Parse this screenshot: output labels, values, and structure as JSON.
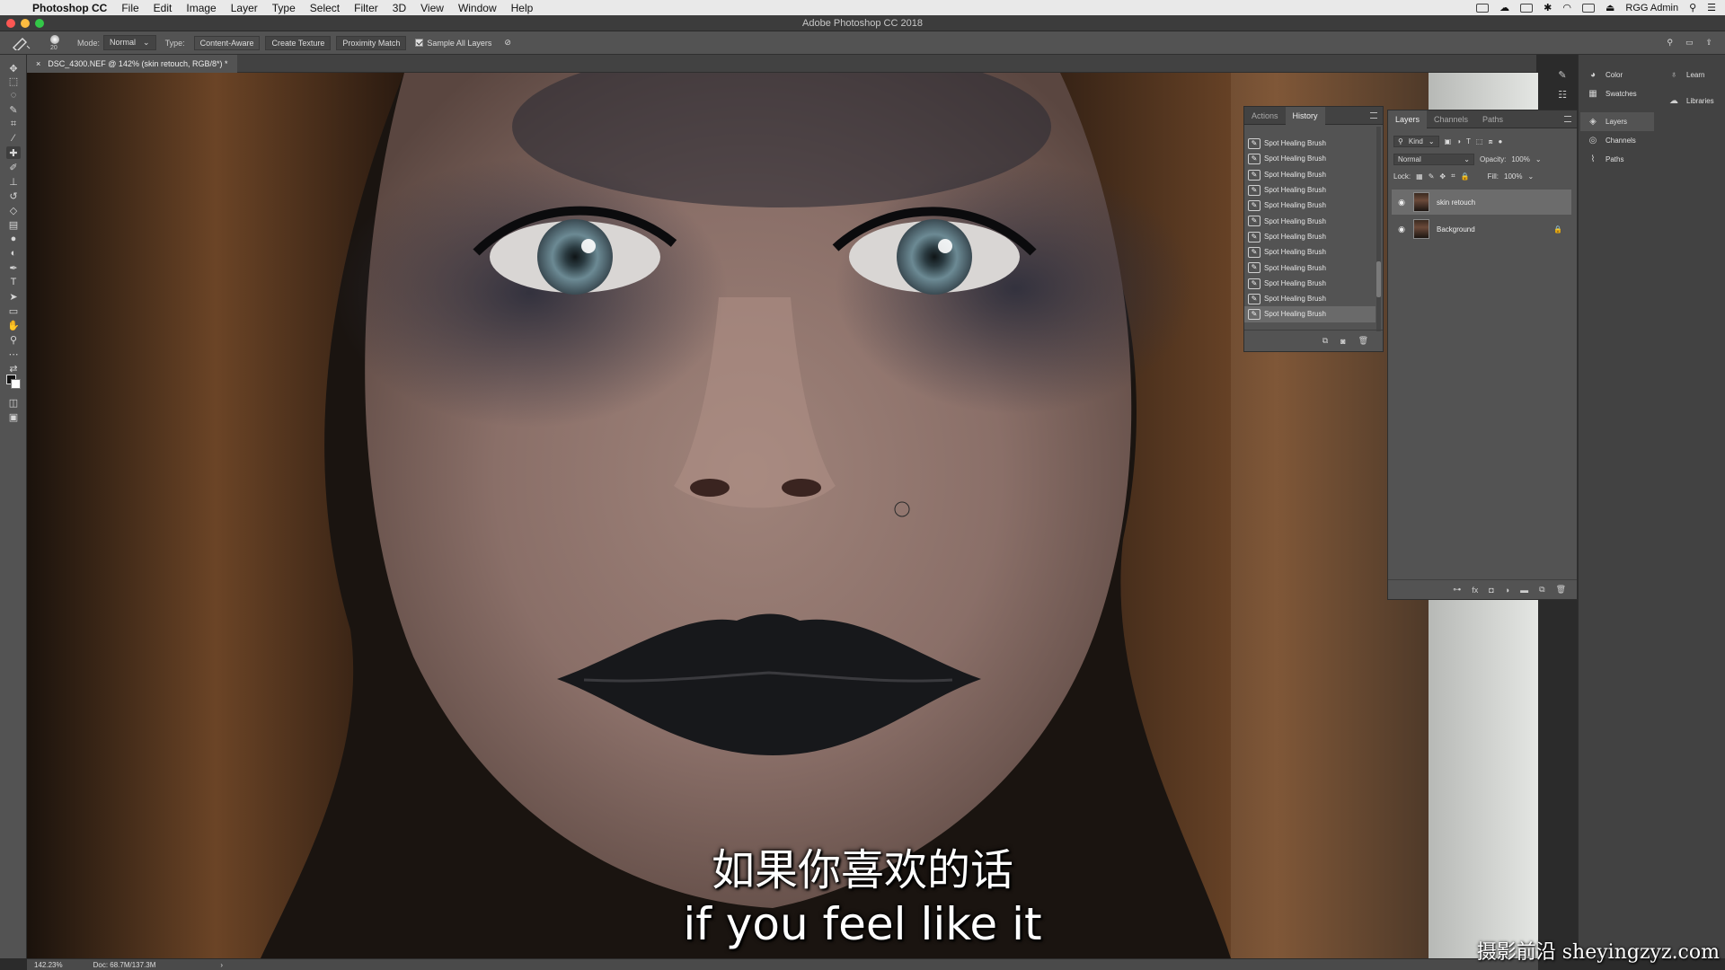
{
  "menubar": {
    "app_name": "Photoshop CC",
    "items": [
      "File",
      "Edit",
      "Image",
      "Layer",
      "Type",
      "Select",
      "Filter",
      "3D",
      "View",
      "Window",
      "Help"
    ],
    "user": "RGG Admin"
  },
  "window": {
    "title": "Adobe Photoshop CC 2018"
  },
  "options_bar": {
    "brush_size": "20",
    "mode_label": "Mode:",
    "mode_value": "Normal",
    "type_label": "Type:",
    "type_options": [
      "Content-Aware",
      "Create Texture",
      "Proximity Match"
    ],
    "sample_all_layers": "Sample All Layers"
  },
  "document": {
    "tab_title": "DSC_4300.NEF @ 142% (skin retouch, RGB/8*) *"
  },
  "status_bar": {
    "zoom": "142.23%",
    "doc_size": "Doc: 68.7M/137.3M"
  },
  "history_panel": {
    "tabs": [
      "Actions",
      "History"
    ],
    "active_tab": "History",
    "items": [
      "Spot Healing Brush",
      "Spot Healing Brush",
      "Spot Healing Brush",
      "Spot Healing Brush",
      "Spot Healing Brush",
      "Spot Healing Brush",
      "Spot Healing Brush",
      "Spot Healing Brush",
      "Spot Healing Brush",
      "Spot Healing Brush",
      "Spot Healing Brush",
      "Spot Healing Brush"
    ]
  },
  "layers_panel": {
    "tabs": [
      "Layers",
      "Channels",
      "Paths"
    ],
    "active_tab": "Layers",
    "filter_kind": "Kind",
    "blend_mode": "Normal",
    "opacity_label": "Opacity:",
    "opacity_value": "100%",
    "lock_label": "Lock:",
    "fill_label": "Fill:",
    "fill_value": "100%",
    "layers": [
      {
        "name": "skin retouch",
        "selected": true
      },
      {
        "name": "Background",
        "locked": true
      }
    ]
  },
  "side_panels": {
    "col1": [
      "Color",
      "Swatches",
      "Layers",
      "Channels",
      "Paths"
    ],
    "col2": [
      "Learn",
      "Libraries"
    ]
  },
  "subtitles": {
    "zh": "如果你喜欢的话",
    "en": "if you feel like it"
  },
  "watermark": "摄影前沿 sheyingzyz.com"
}
